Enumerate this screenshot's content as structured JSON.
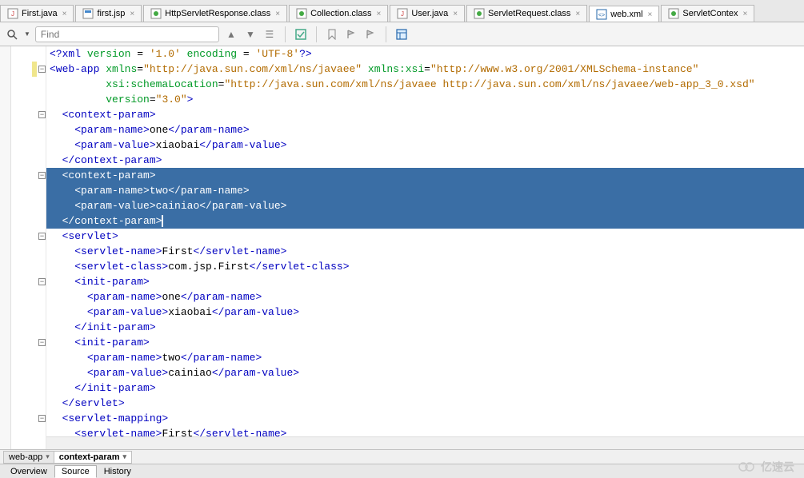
{
  "tabs": [
    {
      "label": "First.java",
      "icon": "java"
    },
    {
      "label": "first.jsp",
      "icon": "jsp"
    },
    {
      "label": "HttpServletResponse.class",
      "icon": "class"
    },
    {
      "label": "Collection.class",
      "icon": "class"
    },
    {
      "label": "User.java",
      "icon": "java"
    },
    {
      "label": "ServletRequest.class",
      "icon": "class"
    },
    {
      "label": "web.xml",
      "icon": "xml",
      "active": true
    },
    {
      "label": "ServletContex",
      "icon": "class"
    }
  ],
  "find": {
    "placeholder": "Find"
  },
  "code": {
    "lines": [
      {
        "fold": null,
        "html": "<span class='proc'>&lt;?xml</span> <span class='attrn'>version</span> = <span class='procv'>'1.0'</span> <span class='attrn'>encoding</span> = <span class='procv'>'UTF-8'</span><span class='proc'>?&gt;</span>"
      },
      {
        "fold": "minus",
        "yellow": true,
        "html": "<span class='tag'>&lt;web-app</span> <span class='attrn'>xmlns</span>=<span class='attrv'>\"http://java.sun.com/xml/ns/javaee\"</span> <span class='attrn'>xmlns:xsi</span>=<span class='attrv'>\"http://www.w3.org/2001/XMLSchema-instance\"</span>"
      },
      {
        "fold": null,
        "html": "         <span class='attrn'>xsi:schemaLocation</span>=<span class='attrv'>\"http://java.sun.com/xml/ns/javaee http://java.sun.com/xml/ns/javaee/web-app_3_0.xsd\"</span>"
      },
      {
        "fold": null,
        "html": "         <span class='attrn'>version</span>=<span class='attrv'>\"3.0\"</span><span class='tag'>&gt;</span>"
      },
      {
        "fold": "minus",
        "html": "  <span class='tag'>&lt;context-param&gt;</span>"
      },
      {
        "fold": null,
        "html": "    <span class='tag'>&lt;param-name&gt;</span><span class='txt'>one</span><span class='tag'>&lt;/param-name&gt;</span>"
      },
      {
        "fold": null,
        "html": "    <span class='tag'>&lt;param-value&gt;</span><span class='txt'>xiaobai</span><span class='tag'>&lt;/param-value&gt;</span>"
      },
      {
        "fold": null,
        "html": "  <span class='tag'>&lt;/context-param&gt;</span>"
      },
      {
        "fold": "minus",
        "sel": true,
        "html": "  <span class='tag'>&lt;context-param&gt;</span>"
      },
      {
        "fold": null,
        "sel": true,
        "html": "    <span class='tag'>&lt;param-name&gt;</span><span class='txt'>two</span><span class='tag'>&lt;/param-name&gt;</span>"
      },
      {
        "fold": null,
        "sel": true,
        "html": "    <span class='tag'>&lt;param-value&gt;</span><span class='txt'>cainiao</span><span class='tag'>&lt;/param-value&gt;</span>"
      },
      {
        "fold": null,
        "sel": true,
        "cursor": true,
        "html": "  <span class='tag'>&lt;/context-param&gt;</span>"
      },
      {
        "fold": "minus",
        "html": "  <span class='tag'>&lt;servlet&gt;</span>"
      },
      {
        "fold": null,
        "html": "    <span class='tag'>&lt;servlet-name&gt;</span><span class='txt'>First</span><span class='tag'>&lt;/servlet-name&gt;</span>"
      },
      {
        "fold": null,
        "html": "    <span class='tag'>&lt;servlet-class&gt;</span><span class='txt'>com.jsp.First</span><span class='tag'>&lt;/servlet-class&gt;</span>"
      },
      {
        "fold": "minus",
        "html": "    <span class='tag'>&lt;init-param&gt;</span>"
      },
      {
        "fold": null,
        "html": "      <span class='tag'>&lt;param-name&gt;</span><span class='txt'>one</span><span class='tag'>&lt;/param-name&gt;</span>"
      },
      {
        "fold": null,
        "html": "      <span class='tag'>&lt;param-value&gt;</span><span class='txt'>xiaobai</span><span class='tag'>&lt;/param-value&gt;</span>"
      },
      {
        "fold": null,
        "html": "    <span class='tag'>&lt;/init-param&gt;</span>"
      },
      {
        "fold": "minus",
        "html": "    <span class='tag'>&lt;init-param&gt;</span>"
      },
      {
        "fold": null,
        "html": "      <span class='tag'>&lt;param-name&gt;</span><span class='txt'>two</span><span class='tag'>&lt;/param-name&gt;</span>"
      },
      {
        "fold": null,
        "html": "      <span class='tag'>&lt;param-value&gt;</span><span class='txt'>cainiao</span><span class='tag'>&lt;/param-value&gt;</span>"
      },
      {
        "fold": null,
        "html": "    <span class='tag'>&lt;/init-param&gt;</span>"
      },
      {
        "fold": null,
        "html": "  <span class='tag'>&lt;/servlet&gt;</span>"
      },
      {
        "fold": "minus",
        "html": "  <span class='tag'>&lt;servlet-mapping&gt;</span>"
      },
      {
        "fold": null,
        "html": "    <span class='tag'>&lt;servlet-name&gt;</span><span class='txt'>First</span><span class='tag'>&lt;/servlet-name&gt;</span>"
      }
    ]
  },
  "breadcrumb": [
    {
      "label": "web-app"
    },
    {
      "label": "context-param",
      "active": true
    }
  ],
  "bottom_tabs": [
    {
      "label": "Overview"
    },
    {
      "label": "Source",
      "active": true
    },
    {
      "label": "History"
    }
  ],
  "watermark": "亿速云"
}
